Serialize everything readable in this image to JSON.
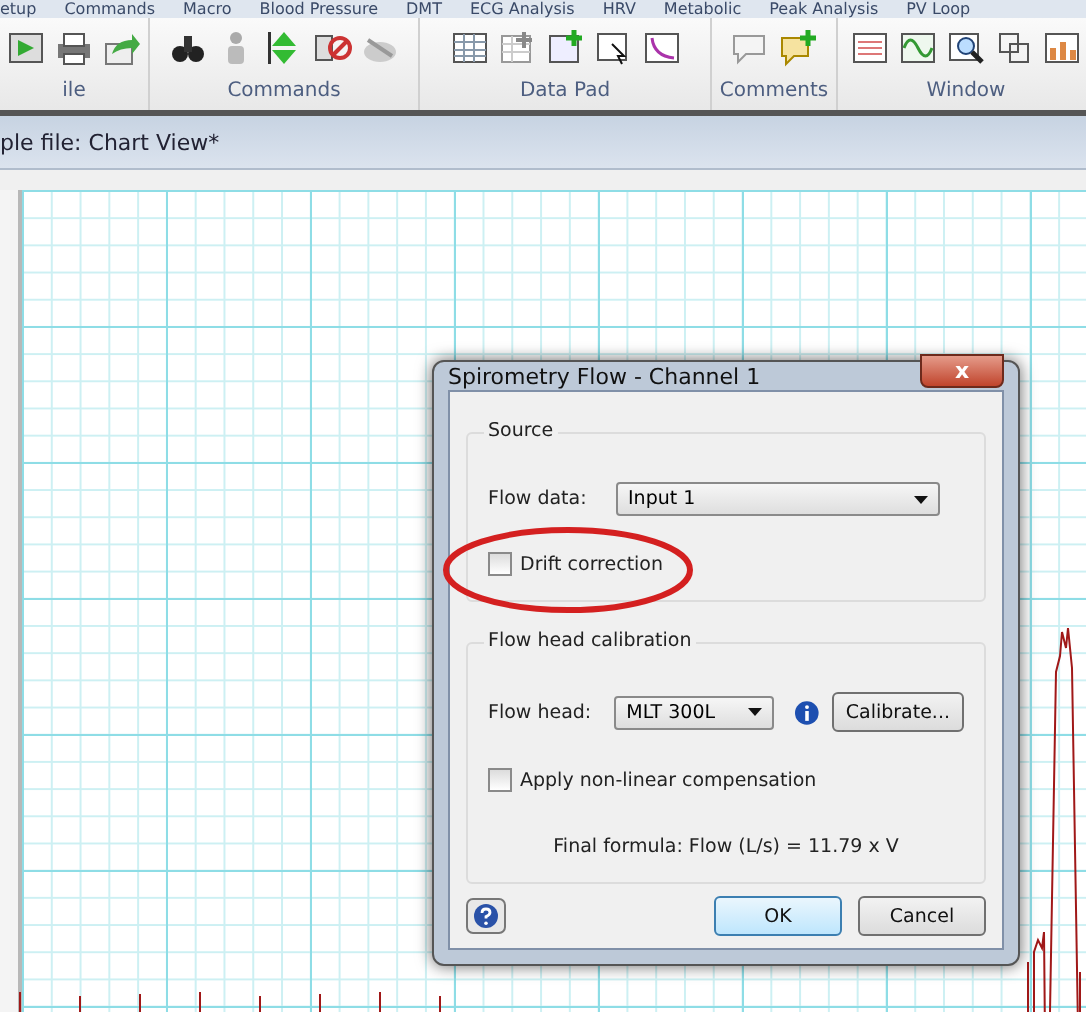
{
  "menu": [
    "etup",
    "Commands",
    "Macro",
    "Blood Pressure",
    "DMT",
    "ECG Analysis",
    "HRV",
    "Metabolic",
    "Peak Analysis",
    "PV Loop"
  ],
  "ribbon_groups": [
    {
      "label": "ile"
    },
    {
      "label": "Commands"
    },
    {
      "label": "Data Pad"
    },
    {
      "label": "Comments"
    },
    {
      "label": "Window"
    }
  ],
  "document_tab": "ple file: Chart View*",
  "dialog": {
    "title": "Spirometry Flow - Channel 1",
    "close": "x",
    "source": {
      "legend": "Source",
      "flow_data_label": "Flow data:",
      "flow_data_value": "Input 1",
      "drift_correction": {
        "label": "Drift correction",
        "checked": false
      }
    },
    "calibration": {
      "legend": "Flow head calibration",
      "flow_head_label": "Flow head:",
      "flow_head_value": "MLT 300L",
      "calibrate_button": "Calibrate...",
      "nonlinear": {
        "label": "Apply non-linear compensation",
        "checked": false
      },
      "formula": "Final formula: Flow (L/s) = 11.79 x V"
    },
    "buttons": [
      {
        "label": "OK",
        "default": true
      },
      {
        "label": "Cancel",
        "default": false
      }
    ]
  }
}
